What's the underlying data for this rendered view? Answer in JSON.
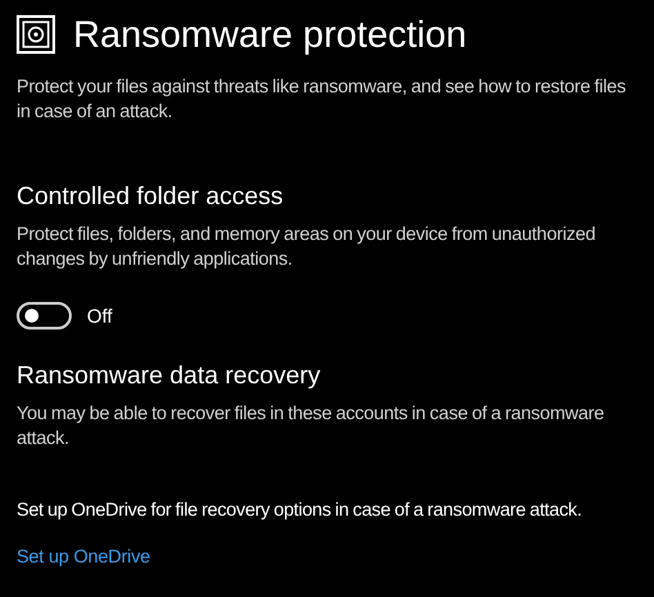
{
  "title": "Ransomware protection",
  "description": "Protect your files against threats like ransomware, and see how to restore files in case of an attack.",
  "sections": [
    {
      "heading": "Controlled folder access",
      "text": "Protect files, folders, and memory areas on your device from unauthorized changes by unfriendly applications.",
      "toggle": {
        "on": false,
        "label": "Off"
      }
    },
    {
      "heading": "Ransomware data recovery",
      "text": "You may be able to recover files in these accounts in case of a ransomware attack."
    }
  ],
  "notice": "Set up OneDrive for file recovery options in case of a ransomware attack.",
  "link": "Set up OneDrive"
}
